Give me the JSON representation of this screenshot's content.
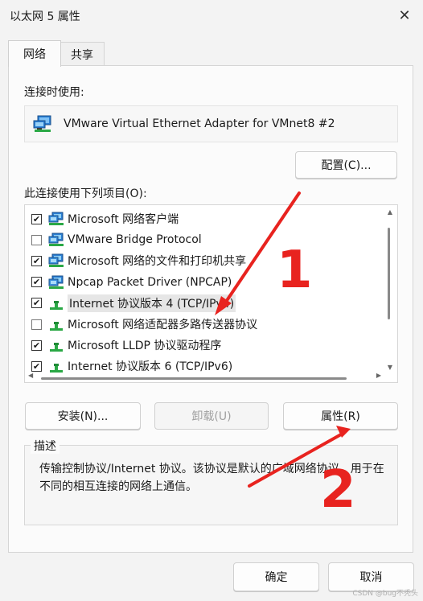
{
  "window": {
    "title": "以太网 5 属性",
    "close_glyph": "✕"
  },
  "tabs": [
    {
      "label": "网络",
      "active": true
    },
    {
      "label": "共享",
      "active": false
    }
  ],
  "connect_using": {
    "label": "连接时使用:",
    "adapter": "VMware Virtual Ethernet Adapter for VMnet8 #2",
    "icon": "network-adapter-icon"
  },
  "configure_button": "配置(C)...",
  "items_label": "此连接使用下列项目(O):",
  "items": [
    {
      "label": "Microsoft 网络客户端",
      "checked": true,
      "icon": "network-client-icon"
    },
    {
      "label": "VMware Bridge Protocol",
      "checked": false,
      "icon": "network-client-icon"
    },
    {
      "label": "Microsoft 网络的文件和打印机共享",
      "checked": true,
      "icon": "network-client-icon"
    },
    {
      "label": "Npcap Packet Driver (NPCAP)",
      "checked": true,
      "icon": "network-client-icon"
    },
    {
      "label": "Internet 协议版本 4 (TCP/IPv4)",
      "checked": true,
      "selected": true,
      "icon": "protocol-icon"
    },
    {
      "label": "Microsoft 网络适配器多路传送器协议",
      "checked": false,
      "icon": "protocol-icon"
    },
    {
      "label": "Microsoft LLDP 协议驱动程序",
      "checked": true,
      "icon": "protocol-icon"
    },
    {
      "label": "Internet 协议版本 6 (TCP/IPv6)",
      "checked": true,
      "icon": "protocol-icon"
    }
  ],
  "buttons": {
    "install": "安装(N)...",
    "uninstall": "卸载(U)",
    "properties": "属性(R)"
  },
  "description": {
    "title": "描述",
    "text": "传输控制协议/Internet 协议。该协议是默认的广域网络协议，用于在不同的相互连接的网络上通信。"
  },
  "footer": {
    "ok": "确定",
    "cancel": "取消"
  },
  "annotations": {
    "one": "1",
    "two": "2",
    "color": "#e8231f"
  },
  "watermark": "CSDN @bug不秃头"
}
